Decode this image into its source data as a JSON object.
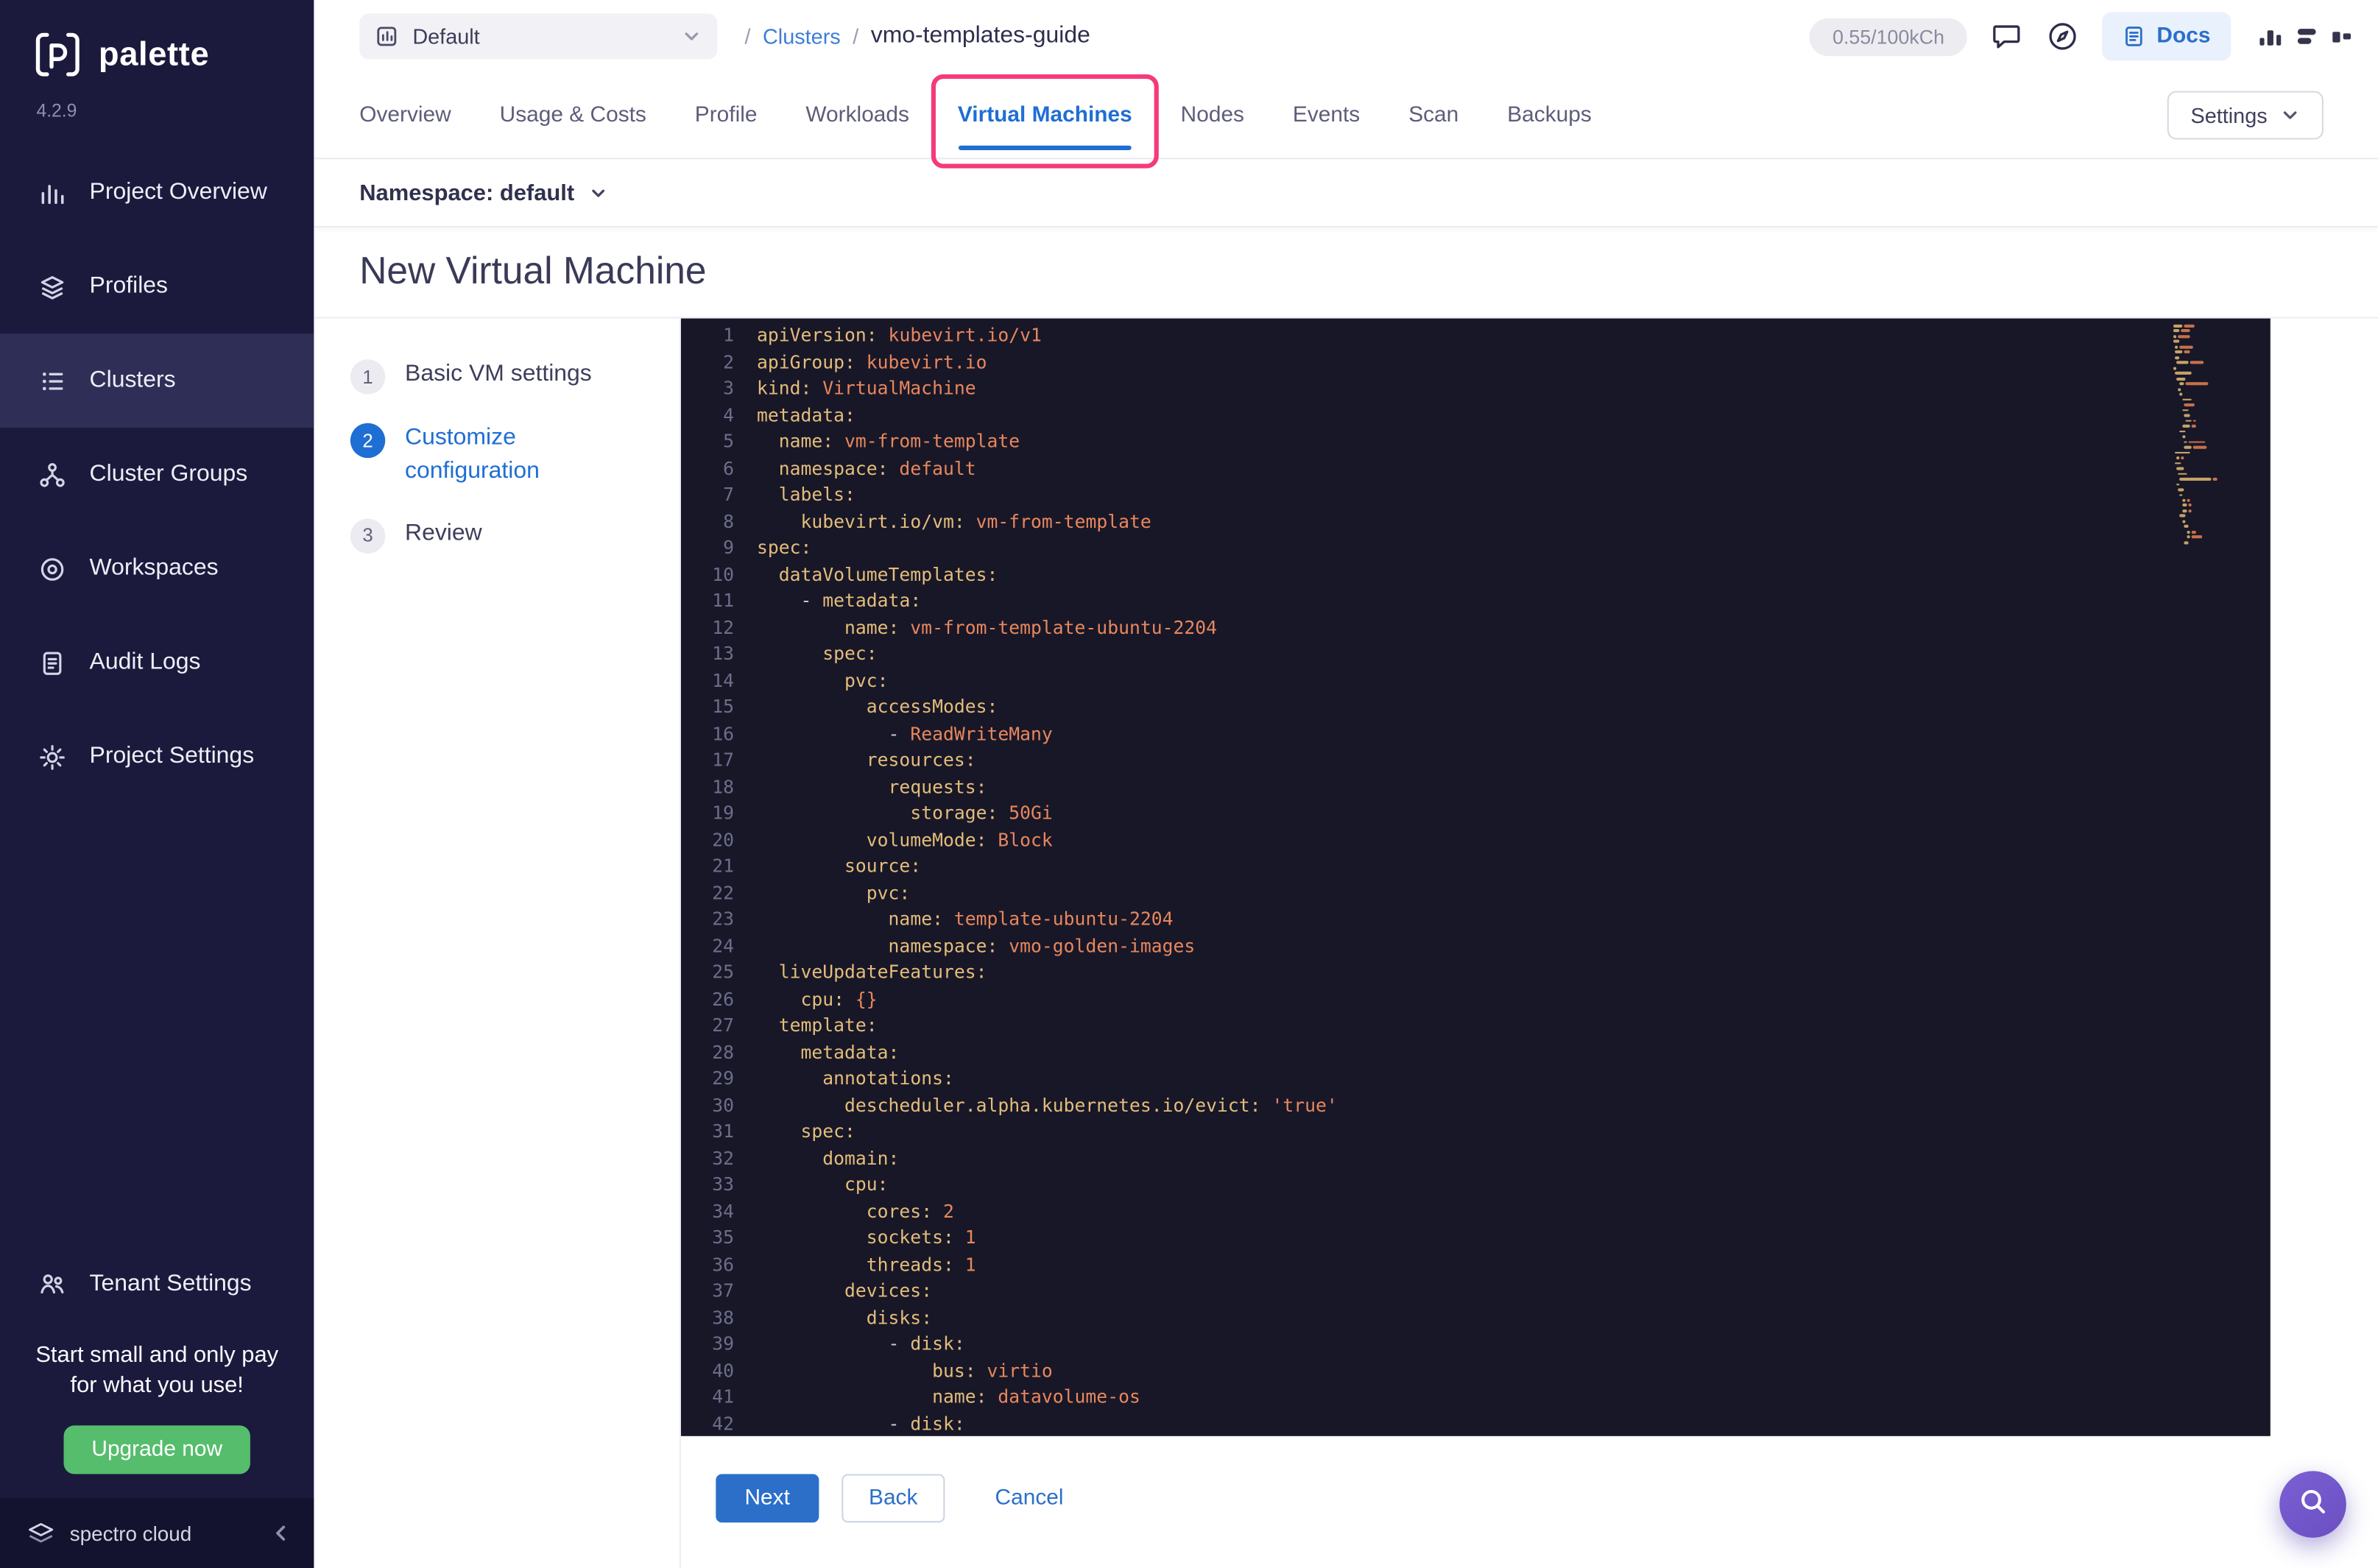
{
  "sidebar": {
    "brand": "palette",
    "version": "4.2.9",
    "items": [
      {
        "label": "Project Overview",
        "icon": "bar-chart",
        "active": false
      },
      {
        "label": "Profiles",
        "icon": "layers",
        "active": false
      },
      {
        "label": "Clusters",
        "icon": "clusters",
        "active": true
      },
      {
        "label": "Cluster Groups",
        "icon": "cluster-groups",
        "active": false
      },
      {
        "label": "Workspaces",
        "icon": "workspaces",
        "active": false
      },
      {
        "label": "Audit Logs",
        "icon": "audit-logs",
        "active": false
      },
      {
        "label": "Project Settings",
        "icon": "settings-gear",
        "active": false
      }
    ],
    "tenant_label": "Tenant Settings",
    "promo_text": "Start small and only pay for what you use!",
    "upgrade_label": "Upgrade now",
    "footer_brand": "spectro cloud"
  },
  "header": {
    "project_selector": "Default",
    "breadcrumb": {
      "sep": "/",
      "parent": "Clusters",
      "current": "vmo-templates-guide"
    },
    "usage_badge": "0.55/100kCh",
    "docs_label": "Docs"
  },
  "tabs": {
    "items": [
      "Overview",
      "Usage & Costs",
      "Profile",
      "Workloads",
      "Virtual Machines",
      "Nodes",
      "Events",
      "Scan",
      "Backups"
    ],
    "active": "Virtual Machines",
    "settings_label": "Settings"
  },
  "namespace_bar": {
    "label": "Namespace: default"
  },
  "page": {
    "title": "New Virtual Machine"
  },
  "stepper": [
    {
      "num": "1",
      "label": "Basic VM settings",
      "active": false
    },
    {
      "num": "2",
      "label": "Customize configuration",
      "active": true
    },
    {
      "num": "3",
      "label": "Review",
      "active": false
    }
  ],
  "editor": {
    "lines": [
      "apiVersion: kubevirt.io/v1",
      "apiGroup: kubevirt.io",
      "kind: VirtualMachine",
      "metadata:",
      "  name: vm-from-template",
      "  namespace: default",
      "  labels:",
      "    kubevirt.io/vm: vm-from-template",
      "spec:",
      "  dataVolumeTemplates:",
      "    - metadata:",
      "        name: vm-from-template-ubuntu-2204",
      "      spec:",
      "        pvc:",
      "          accessModes:",
      "            - ReadWriteMany",
      "          resources:",
      "            requests:",
      "              storage: 50Gi",
      "          volumeMode: Block",
      "        source:",
      "          pvc:",
      "            name: template-ubuntu-2204",
      "            namespace: vmo-golden-images",
      "  liveUpdateFeatures:",
      "    cpu: {}",
      "  template:",
      "    metadata:",
      "      annotations:",
      "        descheduler.alpha.kubernetes.io/evict: 'true'",
      "    spec:",
      "      domain:",
      "        cpu:",
      "          cores: 2",
      "          sockets: 1",
      "          threads: 1",
      "        devices:",
      "          disks:",
      "            - disk:",
      "                bus: virtio",
      "                name: datavolume-os",
      "            - disk:"
    ]
  },
  "footer_actions": {
    "next": "Next",
    "back": "Back",
    "cancel": "Cancel"
  },
  "colors": {
    "accent_blue": "#1f6ed3",
    "annotation_pink": "#f43a7b",
    "upgrade_green": "#55bd6c",
    "sidebar_bg": "#1b1a3d",
    "editor_bg": "#181728",
    "code_key": "#e3bd7a",
    "code_value": "#e8875c"
  }
}
